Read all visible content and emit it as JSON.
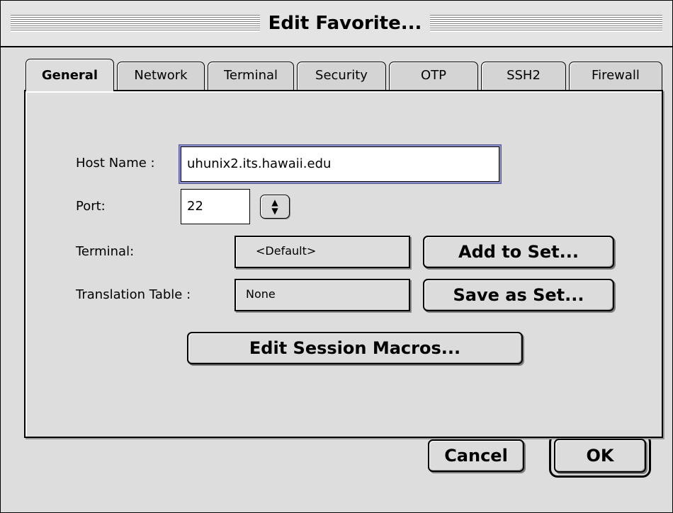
{
  "window": {
    "title": "Edit Favorite..."
  },
  "tabs": [
    {
      "label": "General",
      "active": true
    },
    {
      "label": "Network",
      "active": false
    },
    {
      "label": "Terminal",
      "active": false
    },
    {
      "label": "Security",
      "active": false
    },
    {
      "label": "OTP",
      "active": false
    },
    {
      "label": "SSH2",
      "active": false
    },
    {
      "label": "Firewall",
      "active": false
    }
  ],
  "form": {
    "host_label": "Host Name :",
    "host_value": "uhunix2.its.hawaii.edu",
    "port_label": "Port:",
    "port_value": "22",
    "terminal_label": "Terminal:",
    "terminal_value": "<Default>",
    "translation_label": "Translation Table :",
    "translation_value": "None"
  },
  "buttons": {
    "add_to_set": "Add to Set...",
    "save_as_set": "Save as Set...",
    "edit_session_macros": "Edit Session Macros...",
    "cancel": "Cancel",
    "ok": "OK"
  },
  "colors": {
    "window_bg": "#dddddd",
    "focus_ring": "#8c8cc4"
  }
}
